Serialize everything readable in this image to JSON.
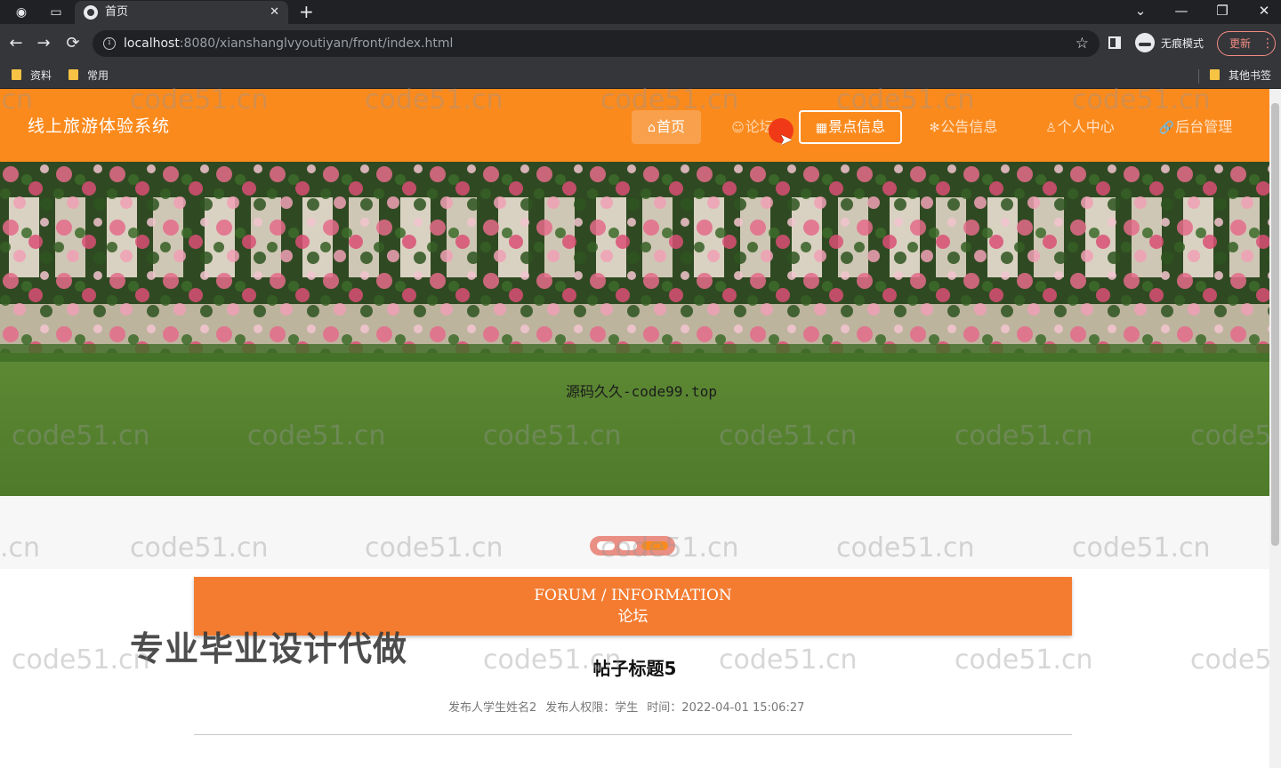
{
  "browser": {
    "tab": {
      "title": "首页",
      "close": "✕"
    },
    "new_tab": "+",
    "window_controls": {
      "menu": "⌄",
      "minimize": "—",
      "restore": "❐",
      "close": "✕"
    },
    "nav": {
      "back": "←",
      "forward": "→",
      "reload": "⟳"
    },
    "url": {
      "host": "localhost",
      "rest": ":8080/xianshanglvyoutiyan/front/index.html"
    },
    "star": "☆",
    "incognito_label": "无痕模式",
    "update_label": "更新",
    "menu_dots": "⋮",
    "bookmarks": [
      {
        "label": "资料"
      },
      {
        "label": "常用"
      }
    ],
    "other_bookmarks": "其他书签"
  },
  "site": {
    "title": "线上旅游体验系统",
    "nav": [
      {
        "icon": "⌂",
        "label": "首页"
      },
      {
        "icon": "☺",
        "label": "论坛"
      },
      {
        "icon": "▦",
        "label": "景点信息"
      },
      {
        "icon": "✻",
        "label": "公告信息"
      },
      {
        "icon": "♙",
        "label": "个人中心"
      },
      {
        "icon": "🔗",
        "label": "后台管理"
      }
    ]
  },
  "banner": {
    "caption": "源码久久-code99.top"
  },
  "carousel": {
    "count": 3,
    "active_index": 2
  },
  "forum": {
    "heading_en": "FORUM / INFORMATION",
    "heading_zh": "论坛",
    "post": {
      "title": "帖子标题5",
      "author": "发布人学生姓名2",
      "role": "发布人权限：学生",
      "time": "时间：2022-04-01 15:06:27"
    }
  },
  "promo_text": "专业毕业设计代做",
  "watermark_text": "code51.cn",
  "colors": {
    "header": "#fb8a1d",
    "section_bar": "#f47c31",
    "active_nav": "#f9a04c"
  }
}
